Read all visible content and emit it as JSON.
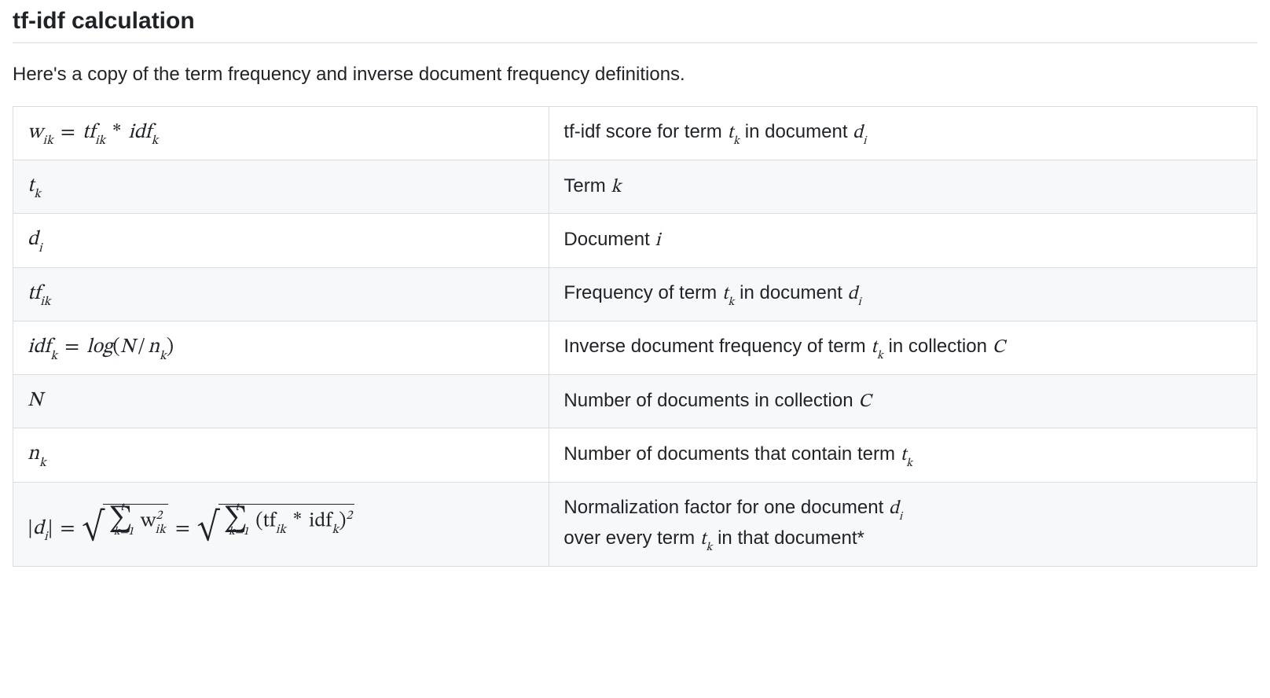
{
  "heading": "tf-idf calculation",
  "intro": "Here's a copy of the term frequency and inverse document frequency definitions.",
  "rows": [
    {
      "formula_html": "<span class=\"math\">w<sub>ik</sub> <span class=\"op\">=</span> tf<sub>ik</sub> <span class=\"op\">*</span> idf<sub>k</sub></span>",
      "desc_html": "tf-idf score for term <span class=\"inline-math\">t<sub>k</sub></span> in document <span class=\"inline-math\">d<sub>i</sub></span>"
    },
    {
      "formula_html": "<span class=\"math\">t<sub>k</sub></span>",
      "desc_html": "Term <span class=\"inline-math\">k</span>"
    },
    {
      "formula_html": "<span class=\"math\">d<sub>i</sub></span>",
      "desc_html": "Document <span class=\"inline-math\">i</span>"
    },
    {
      "formula_html": "<span class=\"math\">tf<sub>ik</sub></span>",
      "desc_html": "Frequency of term <span class=\"inline-math\">t<sub>k</sub></span> in document <span class=\"inline-math\">d<sub>i</sub></span>"
    },
    {
      "formula_html": "<span class=\"math\">idf<sub>k</sub> <span class=\"op\">=</span> log<span class=\"rm\">(</span>N<span class=\"op\">/</span>n<sub>k</sub><span class=\"rm\">)</span></span>",
      "desc_html": "Inverse document frequency of term <span class=\"inline-math\">t<sub>k</sub></span> in collection <span class=\"inline-math\">C</span>"
    },
    {
      "formula_html": "<span class=\"math\">N</span>",
      "desc_html": "Number of documents in collection <span class=\"inline-math\">C</span>"
    },
    {
      "formula_html": "<span class=\"math\">n<sub>k</sub></span>",
      "desc_html": "Number of documents that contain term <span class=\"inline-math\">t<sub>k</sub></span>"
    },
    {
      "formula_html": "<span class=\"math\"><span class=\"rm\">|</span>d<sub>i</sub><span class=\"rm\">|</span> <span class=\"op\">=</span> <span class=\"sqrt\"><span class=\"surd\">&radic;</span><span class=\"vinculum\"><span class=\"sigma\">&sum;<span class=\"top\">t</span><span class=\"bottom\">k=1</span></span> w<sup>2</sup><sub style=\"margin-left:-0.55em;\">ik</sub></span></span> <span class=\"op\">=</span> <span class=\"sqrt\"><span class=\"surd\">&radic;</span><span class=\"vinculum\"><span class=\"sigma\">&sum;<span class=\"top\">t</span><span class=\"bottom\">k=1</span></span> <span class=\"rm\">(</span>tf<sub>ik</sub> <span class=\"op\">*</span> idf<sub>k</sub><span class=\"rm\">)</span><sup>2</sup></span></span></span>",
      "desc_html": "Normalization factor for one document <span class=\"inline-math\">d<sub>i</sub></span><br>over every term <span class=\"inline-math\">t<sub>k</sub></span> in that document*"
    }
  ]
}
